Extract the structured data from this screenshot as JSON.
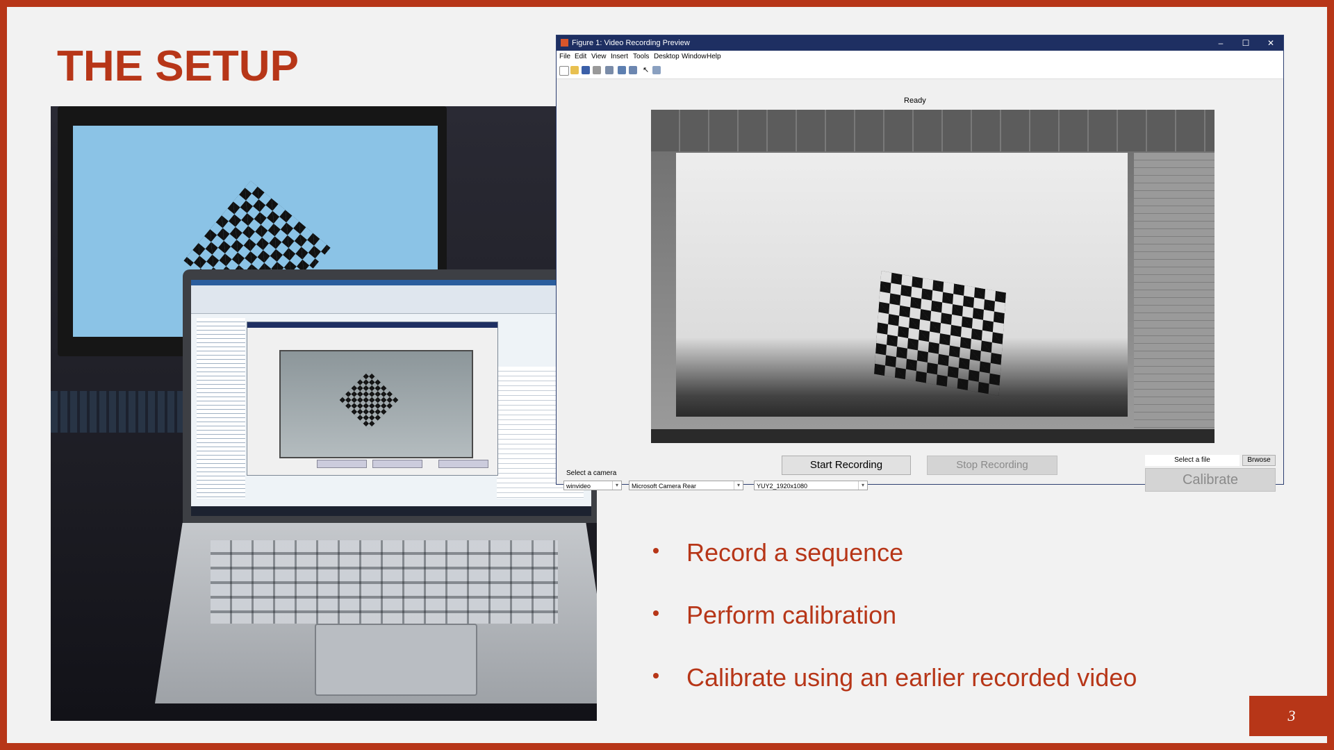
{
  "slide": {
    "title": "THE SETUP",
    "page_number": "3",
    "accent_color": "#b73618",
    "bullets": [
      "Record a sequence",
      "Perform calibration",
      "Calibrate using an earlier recorded video"
    ]
  },
  "figure_window": {
    "title": "Figure 1: Video Recording Preview",
    "menus": [
      "File",
      "Edit",
      "View",
      "Insert",
      "Tools",
      "Desktop",
      "Window",
      "Help"
    ],
    "status": "Ready",
    "select_camera_label": "Select a camera",
    "adaptor_select": "winvideo",
    "camera_select": "Microsoft Camera Rear",
    "format_select": "YUY2_1920x1080",
    "start_recording_label": "Start Recording",
    "stop_recording_label": "Stop Recording",
    "select_file_label": "Select a file",
    "browse_label": "Brwose",
    "calibrate_label": "Calibrate",
    "toolbar_icons": [
      "new-file-icon",
      "open-folder-icon",
      "save-icon",
      "print-icon",
      "print-preview-icon",
      "dock-icon",
      "layout-icon",
      "pointer-icon",
      "panel-icon"
    ]
  },
  "photo": {
    "description_icons": [
      "monitor",
      "laptop",
      "checkerboard"
    ]
  }
}
